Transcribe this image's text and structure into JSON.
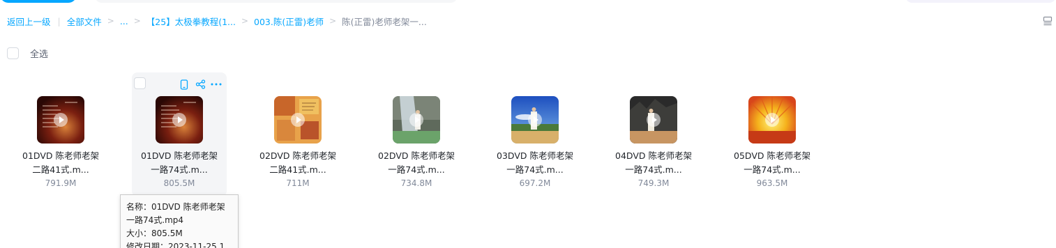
{
  "breadcrumb": {
    "back": "返回上一级",
    "all_files": "全部文件",
    "ellipsis": "...",
    "level1": "【25】太极拳教程(1...",
    "level2": "003.陈(正雷)老师",
    "current": "陈(正雷)老师老架一..."
  },
  "toolbar": {
    "select_all": "全选",
    "view_icon": "list-view-icon"
  },
  "files": [
    {
      "name_line1": "01DVD 陈老师老架",
      "name_line2": "二路41式.m...",
      "size": "791.9M",
      "thumb": "red-title-card"
    },
    {
      "name_line1": "01DVD 陈老师老架",
      "name_line2": "一路74式.m...",
      "size": "805.5M",
      "thumb": "red-title-card"
    },
    {
      "name_line1": "02DVD 陈老师老架",
      "name_line2": "二路41式.m...",
      "size": "711M",
      "thumb": "orange-collage"
    },
    {
      "name_line1": "02DVD 陈老师老架",
      "name_line2": "一路74式.m...",
      "size": "734.8M",
      "thumb": "waterfall"
    },
    {
      "name_line1": "03DVD 陈老师老架",
      "name_line2": "一路74式.m...",
      "size": "697.2M",
      "thumb": "blue-sky-lake"
    },
    {
      "name_line1": "04DVD 陈老师老架",
      "name_line2": "一路74式.m...",
      "size": "749.3M",
      "thumb": "rocky-cliff"
    },
    {
      "name_line1": "05DVD 陈老师老架",
      "name_line2": "一路74式.m...",
      "size": "963.5M",
      "thumb": "sunset-fan"
    }
  ],
  "hover_actions": {
    "phone": "phone-icon",
    "share": "share-icon",
    "more": "more-icon"
  },
  "tooltip": {
    "name_line1": "名称：01DVD 陈老师老架",
    "name_line2": "一路74式.mp4",
    "size": "大小：805.5M",
    "modified": "修改日期：2023-11-25 1"
  },
  "colors": {
    "accent": "#06a7ff",
    "muted": "#818999",
    "text": "#1f2329"
  }
}
